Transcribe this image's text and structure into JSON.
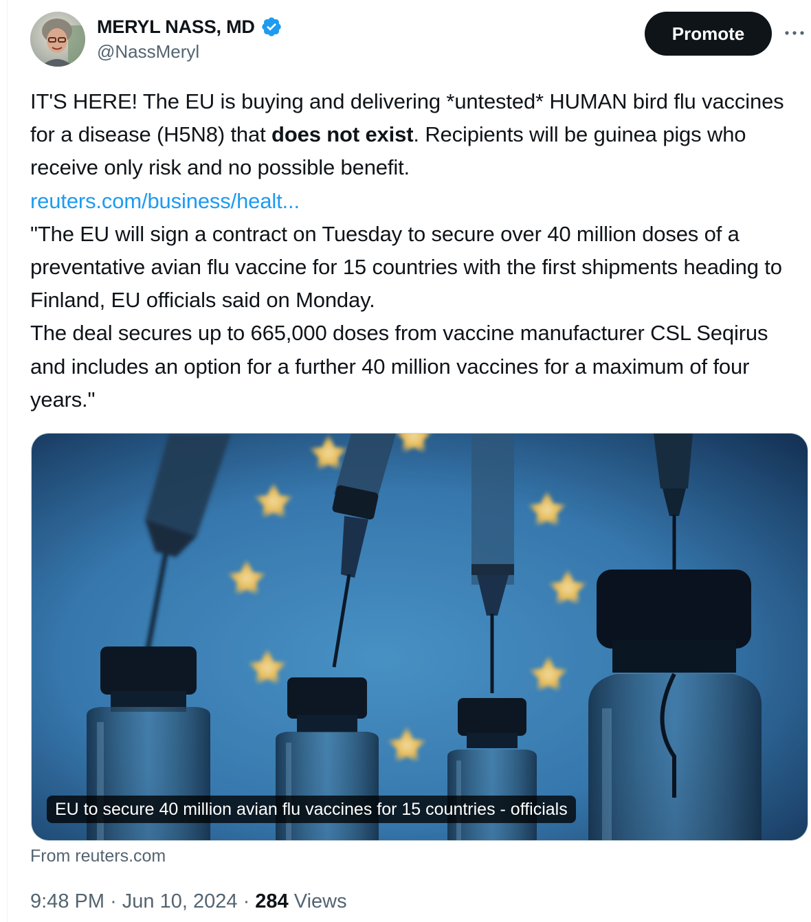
{
  "author": {
    "display_name": "MERYL NASS, MD",
    "handle": "@NassMeryl",
    "avatar_icon": "profile-photo",
    "verified_icon": "verified-badge-icon",
    "verified_color": "#1d9bf0"
  },
  "actions": {
    "promote_label": "Promote",
    "more_icon": "ellipsis-icon"
  },
  "tweet": {
    "line1_pre": "IT'S HERE!  The EU is buying and delivering *untested* HUMAN bird flu vaccines for a disease (H5N8) that ",
    "line1_bold": "does not exist",
    "line1_post": ". Recipients will be guinea pigs who receive only risk and no possible benefit.",
    "link_text": "reuters.com/business/healt...",
    "quote_p1": "\"The  EU will sign a contract on Tuesday to secure over 40 million doses of a  preventative avian flu vaccine for 15 countries with the first shipments heading to Finland, EU officials said on Monday.",
    "quote_p2": "The  deal secures up to 665,000 doses from vaccine manufacturer CSL Seqirus  and includes an option for a further 40 million vaccines for a maximum  of four years.\""
  },
  "card": {
    "headline": "EU to secure 40 million avian flu vaccines for 15 countries - officials",
    "source": "From reuters.com"
  },
  "meta": {
    "time": "9:48 PM",
    "separator": "·",
    "date": "Jun 10, 2024",
    "views_count": "284",
    "views_label": "Views"
  },
  "colors": {
    "link": "#1d9bf0",
    "text_secondary": "#536471",
    "button_bg": "#0f1419"
  }
}
